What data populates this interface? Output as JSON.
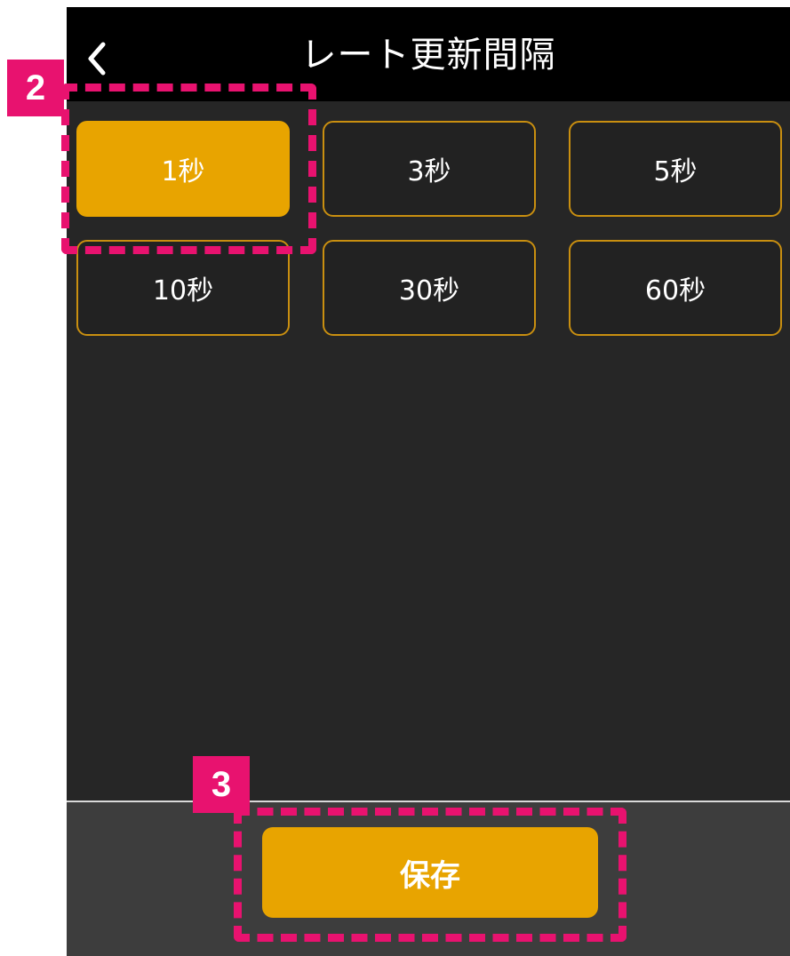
{
  "header": {
    "title": "レート更新間隔",
    "back_icon": "chevron-left-icon"
  },
  "intervals": [
    {
      "label": "1秒",
      "selected": true
    },
    {
      "label": "3秒",
      "selected": false
    },
    {
      "label": "5秒",
      "selected": false
    },
    {
      "label": "10秒",
      "selected": false
    },
    {
      "label": "30秒",
      "selected": false
    },
    {
      "label": "60秒",
      "selected": false
    }
  ],
  "footer": {
    "save_label": "保存"
  },
  "callouts": [
    {
      "number": "2",
      "target": "1秒"
    },
    {
      "number": "3",
      "target": "保存"
    }
  ],
  "colors": {
    "accent": "#e8a400",
    "callout": "#e8126f",
    "button_border": "#c98f10",
    "background": "#262626",
    "header": "#000000",
    "footer": "#3d3d3d"
  }
}
